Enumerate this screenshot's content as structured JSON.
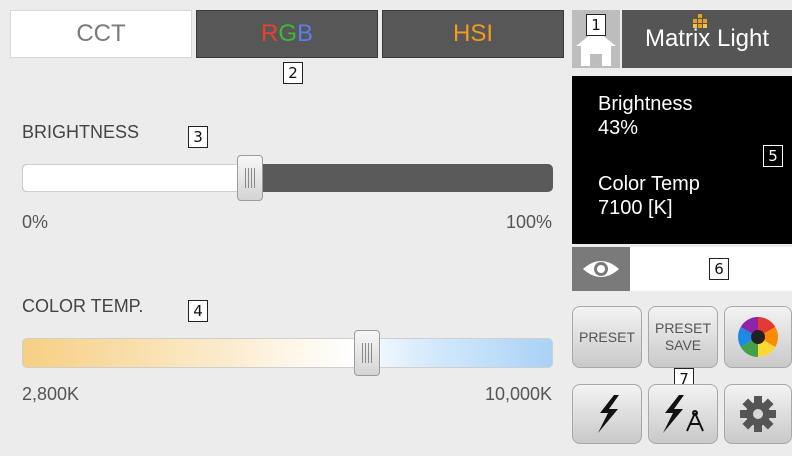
{
  "tabs": {
    "cct": "CCT",
    "hsi": "HSI",
    "rgb": {
      "r": "R",
      "g": "G",
      "b": "B"
    }
  },
  "brand": {
    "name": "Matrix Light"
  },
  "brightness": {
    "label": "BRIGHTNESS",
    "min_label": "0%",
    "max_label": "100%",
    "value_fraction": 0.43
  },
  "color_temp": {
    "label": "COLOR TEMP.",
    "min_label": "2,800K",
    "max_label": "10,000K",
    "value_fraction": 0.65
  },
  "info_panel": {
    "brightness_title": "Brightness",
    "brightness_value": "43%",
    "temp_title": "Color  Temp",
    "temp_value": "7100  [K]"
  },
  "buttons": {
    "preset": "PRESET",
    "preset_save_line1": "PRESET",
    "preset_save_line2": "SAVE"
  },
  "callouts": [
    "1",
    "2",
    "3",
    "4",
    "5",
    "6",
    "7"
  ],
  "colors": {
    "tab_active": "#ffffff",
    "tab_inactive": "#575757",
    "hsi_text": "#f59a1b",
    "rgb_r": "#e8402a",
    "rgb_g": "#3cb83c",
    "rgb_b": "#5a7fe8",
    "info_bg": "#000000",
    "brand_bg": "#555555"
  },
  "icons": [
    "home-icon",
    "eye-icon",
    "color-wheel-icon",
    "lightning-icon",
    "lightning-compass-icon",
    "gear-icon",
    "logo-diamond-icon"
  ]
}
